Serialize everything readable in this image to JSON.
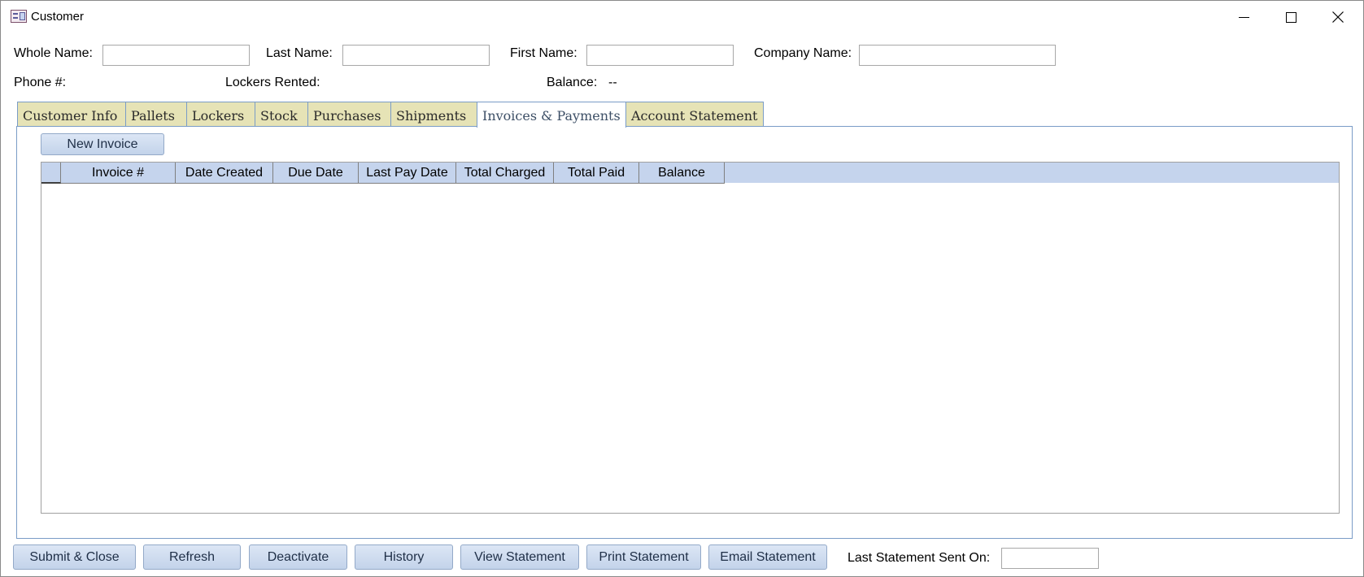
{
  "window": {
    "title": "Customer"
  },
  "header": {
    "whole_name_label": "Whole Name:",
    "whole_name_value": "",
    "last_name_label": "Last Name:",
    "last_name_value": "",
    "first_name_label": "First Name:",
    "first_name_value": "",
    "company_name_label": "Company Name:",
    "company_name_value": "",
    "phone_label": "Phone #:",
    "phone_value": "",
    "lockers_label": "Lockers Rented:",
    "lockers_value": "",
    "balance_label": "Balance:",
    "balance_value": "--"
  },
  "tabs": [
    {
      "label": "Customer Info",
      "active": false
    },
    {
      "label": "Pallets",
      "active": false
    },
    {
      "label": "Lockers",
      "active": false
    },
    {
      "label": "Stock",
      "active": false
    },
    {
      "label": "Purchases",
      "active": false
    },
    {
      "label": "Shipments",
      "active": false
    },
    {
      "label": "Invoices & Payments",
      "active": true
    },
    {
      "label": "Account Statement",
      "active": false
    }
  ],
  "invoices": {
    "new_invoice_label": "New Invoice",
    "columns": [
      "Invoice #",
      "Date Created",
      "Due Date",
      "Last Pay Date",
      "Total Charged",
      "Total Paid",
      "Balance"
    ],
    "rows": []
  },
  "footer": {
    "submit_close": "Submit & Close",
    "refresh": "Refresh",
    "deactivate": "Deactivate",
    "history": "History",
    "view_statement": "View Statement",
    "print_statement": "Print Statement",
    "email_statement": "Email Statement",
    "last_statement_label": "Last Statement Sent On:",
    "last_statement_value": ""
  },
  "colors": {
    "tab_inactive": "#e6e3b6",
    "tab_border": "#7a9cc7",
    "grid_header": "#c5d4ed",
    "button_face": "#c3d3ea"
  }
}
